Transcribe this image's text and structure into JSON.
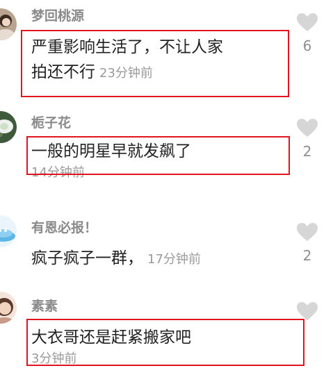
{
  "comments": [
    {
      "username": "梦回桃源",
      "text_line1": "严重影响生活了，不让人家",
      "text_line2": "拍还不行",
      "time": "23分钟前",
      "likes": "6"
    },
    {
      "username": "栀子花",
      "text": "一般的明星早就发飙了",
      "time": "14分钟前",
      "likes": "2"
    },
    {
      "username": "有恩必报！",
      "text": "疯子疯子一群，",
      "time": "17分钟前",
      "likes": "2"
    },
    {
      "username": "素素",
      "text": "大衣哥还是赶紧搬家吧",
      "time": "3分钟前",
      "likes": ""
    }
  ],
  "icons": {
    "like": "heart-icon"
  },
  "colors": {
    "highlight_border": "#e0141e",
    "username": "#8a8a8a",
    "meta": "#9a9a9a",
    "heart": "#d6d6d6"
  }
}
